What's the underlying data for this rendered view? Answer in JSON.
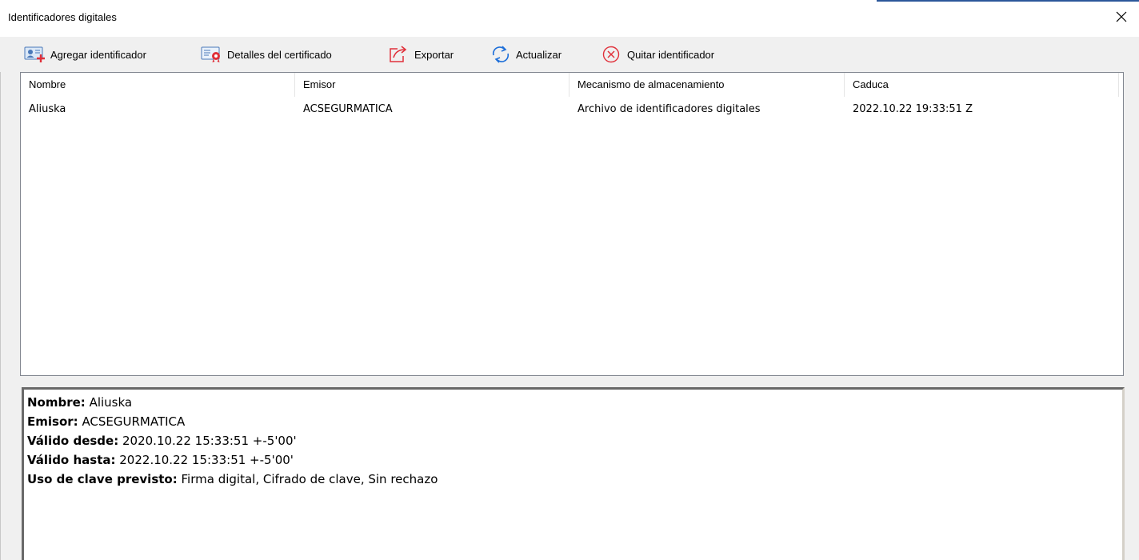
{
  "window": {
    "title": "Identificadores digitales"
  },
  "toolbar": {
    "add_label": "Agregar identificador",
    "details_label": "Detalles del certificado",
    "export_label": "Exportar",
    "refresh_label": "Actualizar",
    "remove_label": "Quitar identificador"
  },
  "table": {
    "columns": [
      "Nombre",
      "Emisor",
      "Mecanismo de almacenamiento",
      "Caduca"
    ],
    "rows": [
      [
        "Aliuska",
        "ACSEGURMATICA",
        "Archivo de identificadores digitales",
        "2022.10.22 19:33:51 Z"
      ]
    ]
  },
  "details": {
    "name_key": "Nombre:",
    "name_value": "Aliuska",
    "issuer_key": "Emisor:",
    "issuer_value": "ACSEGURMATICA",
    "valid_from_key": "Válido desde:",
    "valid_from_value": "2020.10.22 15:33:51 +-5'00'",
    "valid_to_key": "Válido hasta:",
    "valid_to_value": "2022.10.22 15:33:51 +-5'00'",
    "key_usage_key": "Uso de clave previsto:",
    "key_usage_value": "Firma digital, Cifrado de clave, Sin rechazo"
  },
  "icons": {
    "add": "person-card-add-icon",
    "details": "certificate-details-icon",
    "export": "export-arrow-icon",
    "refresh": "refresh-icon",
    "remove": "remove-circle-x-icon",
    "close": "close-icon"
  },
  "colors": {
    "accent": "#1e6fd9",
    "danger": "#e0303a",
    "border": "#828790"
  }
}
